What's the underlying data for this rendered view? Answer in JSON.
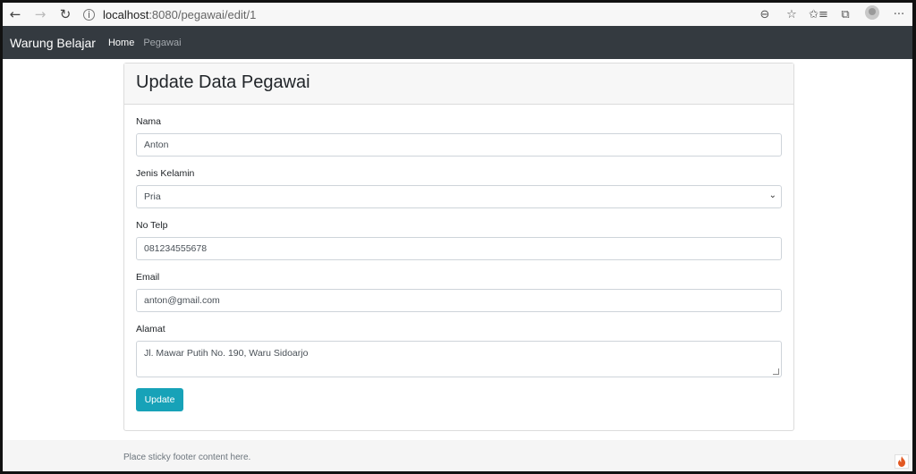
{
  "browser": {
    "url_host": "localhost",
    "url_path": ":8080/pegawai/edit/1",
    "back_icon": "←",
    "forward_icon": "→",
    "refresh_icon": "↻",
    "info_icon": "i",
    "zoom_icon": "⊖",
    "favorite_icon": "☆",
    "favorites_list_icon": "✩≡",
    "collections_icon": "⧉",
    "more_icon": "···"
  },
  "navbar": {
    "brand": "Warung Belajar",
    "links": [
      "Home",
      "Pegawai"
    ]
  },
  "card": {
    "title": "Update Data Pegawai"
  },
  "form": {
    "nama_label": "Nama",
    "nama_value": "Anton",
    "jk_label": "Jenis Kelamin",
    "jk_value": "Pria",
    "telp_label": "No Telp",
    "telp_value": "081234555678",
    "email_label": "Email",
    "email_value": "anton@gmail.com",
    "alamat_label": "Alamat",
    "alamat_value": "Jl. Mawar Putih No. 190, Waru Sidoarjo",
    "submit_label": "Update",
    "chevron_icon": "⌄"
  },
  "footer": {
    "text": "Place sticky footer content here."
  },
  "colors": {
    "navbar": "#343a40",
    "button": "#17a2b8",
    "footer": "#f5f5f5",
    "flame": "#e25822"
  }
}
